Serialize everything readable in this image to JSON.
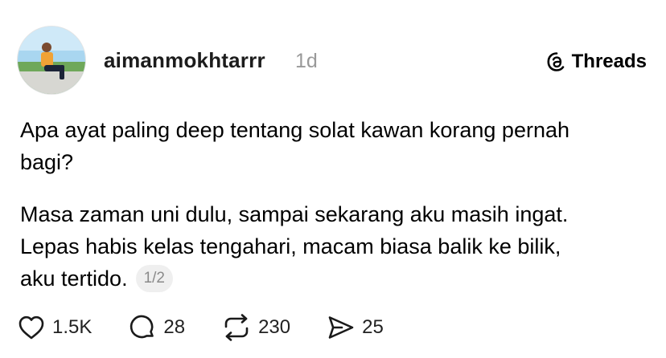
{
  "post": {
    "username": "aimanmokhtarrr",
    "timestamp": "1d",
    "brand": {
      "label": "Threads",
      "icon": "threads-logo-icon"
    },
    "body": {
      "paragraph_1": [
        "Apa ayat paling deep tentang solat kawan korang pernah",
        "bagi?"
      ],
      "paragraph_2": [
        "Masa zaman uni dulu, sampai sekarang aku masih ingat.",
        "Lepas habis kelas tengahari, macam biasa balik ke bilik,",
        "aku tertido."
      ],
      "page_indicator": "1/2"
    },
    "actions": {
      "likes": {
        "icon": "heart-icon",
        "count": "1.5K"
      },
      "comments": {
        "icon": "comment-icon",
        "count": "28"
      },
      "reposts": {
        "icon": "repost-icon",
        "count": "230"
      },
      "shares": {
        "icon": "share-icon",
        "count": "25"
      }
    }
  },
  "colors": {
    "text": "#000000",
    "muted": "#999999",
    "badge_bg": "#efefef"
  }
}
